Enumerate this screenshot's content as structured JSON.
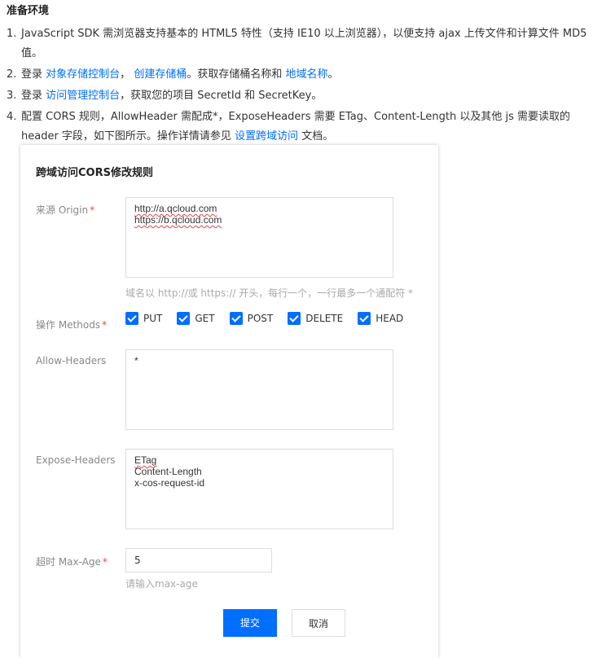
{
  "section_title": "准备环境",
  "steps": [
    {
      "num": "1.",
      "text": "JavaScript SDK 需浏览器支持基本的 HTML5 特性（支持 IE10 以上浏览器），以便支持 ajax 上传文件和计算文件 MD5 值。"
    },
    {
      "num": "2.",
      "prefix": "登录",
      "link1": "对象存储控制台",
      "sep1": "，",
      "link2": "创建存储桶",
      "mid": "。获取存储桶名称和",
      "link3": "地域名称",
      "suffix": "。"
    },
    {
      "num": "3.",
      "prefix": "登录",
      "link1": "访问管理控制台",
      "suffix": "，获取您的项目 SecretId 和 SecretKey。"
    },
    {
      "num": "4.",
      "text": "配置 CORS 规则，AllowHeader 需配成*，ExposeHeaders 需要 ETag、Content-Length 以及其他 js 需要读取的 header 字段，如下图所示。操作详情请参见",
      "link1": "设置跨域访问",
      "suffix": "文档。"
    }
  ],
  "panel": {
    "title": "跨域访问CORS修改规则",
    "origin": {
      "label": "来源 Origin",
      "required_mark": "*",
      "lines": [
        "http://a.qcloud.com",
        "https://b.qcloud.com"
      ],
      "hint": "域名以 http://或 https:// 开头，每行一个，一行最多一个通配符 *"
    },
    "methods": {
      "label": "操作 Methods",
      "required_mark": "*",
      "options": [
        {
          "label": "PUT",
          "checked": true
        },
        {
          "label": "GET",
          "checked": true
        },
        {
          "label": "POST",
          "checked": true
        },
        {
          "label": "DELETE",
          "checked": true
        },
        {
          "label": "HEAD",
          "checked": true
        }
      ]
    },
    "allow_headers": {
      "label": "Allow-Headers",
      "value": "*"
    },
    "expose_headers": {
      "label": "Expose-Headers",
      "lines": [
        "ETag",
        "Content-Length",
        "x-cos-request-id"
      ]
    },
    "max_age": {
      "label": "超时 Max-Age",
      "required_mark": "*",
      "value": "5",
      "hint": "请输入max-age"
    },
    "submit_label": "提交",
    "cancel_label": "取消"
  },
  "colors": {
    "link": "#006eff",
    "primary": "#006eff",
    "required": "#e54545"
  }
}
